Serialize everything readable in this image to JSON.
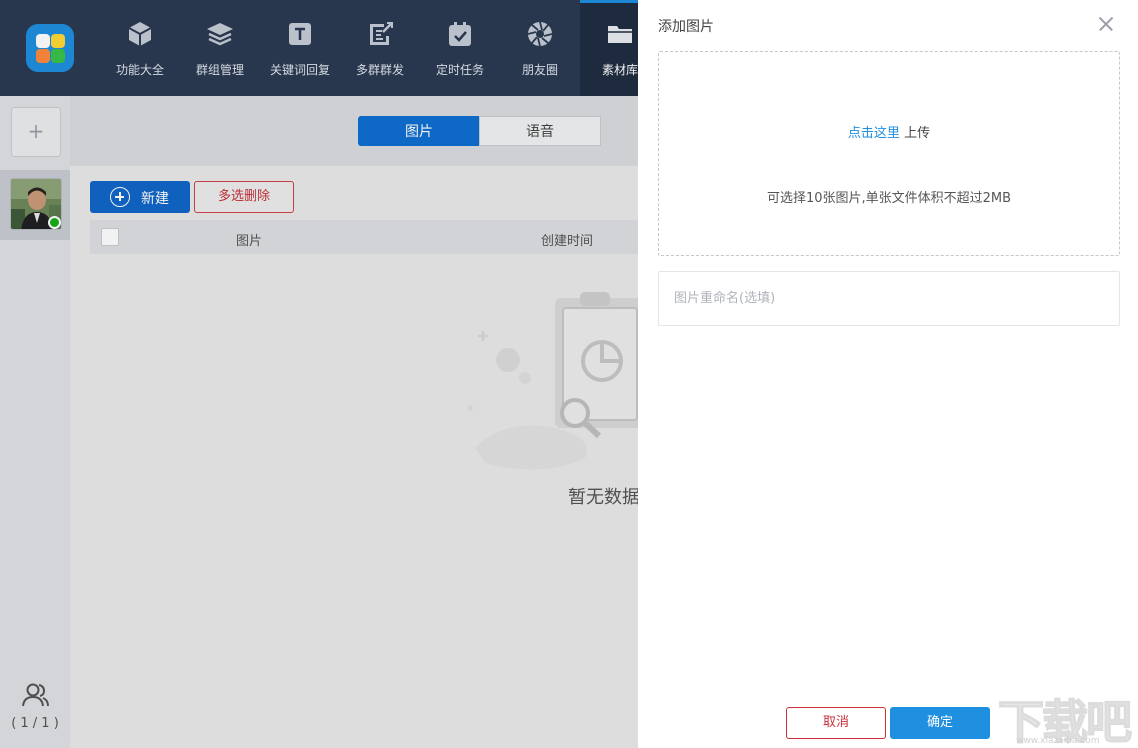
{
  "nav": {
    "items": [
      {
        "label": "功能大全",
        "icon": "cube-icon"
      },
      {
        "label": "群组管理",
        "icon": "layers-icon"
      },
      {
        "label": "关键词回复",
        "icon": "text-t-icon"
      },
      {
        "label": "多群群发",
        "icon": "broadcast-edit-icon"
      },
      {
        "label": "定时任务",
        "icon": "calendar-check-icon"
      },
      {
        "label": "朋友圈",
        "icon": "camera-aperture-icon"
      },
      {
        "label": "素材库",
        "icon": "folder-icon"
      }
    ]
  },
  "sidebar": {
    "add_label": "+",
    "account_count": "( 1 / 1 )"
  },
  "main": {
    "tabs": [
      "图片",
      "语音"
    ],
    "new_button": "新建",
    "multi_delete_button": "多选删除",
    "columns": [
      "图片",
      "创建时间"
    ],
    "empty_text": "暂无数据"
  },
  "panel": {
    "title": "添加图片",
    "upload_link": "点击这里",
    "upload_action": "上传",
    "upload_hint": "可选择10张图片,单张文件体积不超过2MB",
    "rename_placeholder": "图片重命名(选填)",
    "cancel": "取消",
    "confirm": "确定"
  },
  "watermark": {
    "text": "下载吧",
    "url": "www.xiazaiba.com"
  },
  "colors": {
    "topbar": "#2b3a52",
    "accent": "#1f8fe0",
    "danger": "#c9303a",
    "online": "#1aad19"
  }
}
